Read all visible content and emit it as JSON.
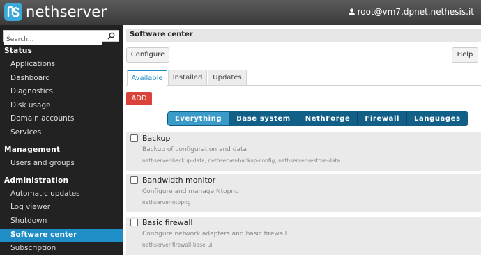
{
  "header": {
    "logo_text": "nethserver",
    "user_label": "root@vm7.dpnet.nethesis.it"
  },
  "sidebar": {
    "search_placeholder": "Search...",
    "sections": [
      {
        "title": "Status",
        "items": [
          "Applications",
          "Dashboard",
          "Diagnostics",
          "Disk usage",
          "Domain accounts",
          "Services"
        ]
      },
      {
        "title": "Management",
        "items": [
          "Users and groups"
        ]
      },
      {
        "title": "Administration",
        "items": [
          "Automatic updates",
          "Log viewer",
          "Shutdown",
          "Software center",
          "Subscription"
        ]
      }
    ],
    "active_item": "Software center"
  },
  "main": {
    "page_title": "Software center",
    "configure_label": "Configure",
    "help_label": "Help",
    "tabs": [
      "Available",
      "Installed",
      "Updates"
    ],
    "active_tab": "Available",
    "add_label": "ADD",
    "filters": [
      "Everything",
      "Base system",
      "NethForge",
      "Firewall",
      "Languages"
    ],
    "active_filter": "Everything",
    "packages": [
      {
        "name": "Backup",
        "description": "Backup of configuration and data",
        "rpms": "nethserver-backup-data, nethserver-backup-config, nethserver-restore-data"
      },
      {
        "name": "Bandwidth monitor",
        "description": "Configure and manage Ntopng",
        "rpms": "nethserver-ntopng"
      },
      {
        "name": "Basic firewall",
        "description": "Configure network adapters and basic firewall",
        "rpms": "nethserver-firewall-base-ui"
      }
    ]
  },
  "colors": {
    "accent": "#1f8dc6",
    "add_button": "#d9433a",
    "filter_bg": "#125f88",
    "filter_active": "#3a9bc8",
    "sidebar_bg": "#222222"
  }
}
